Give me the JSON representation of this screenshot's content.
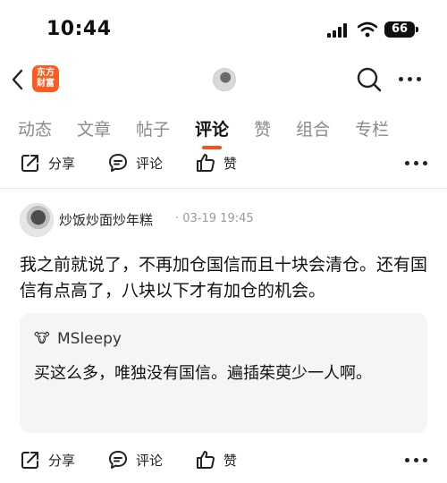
{
  "status_bar": {
    "time": "10:44",
    "battery": "66"
  },
  "nav": {
    "logo_line1": "东方",
    "logo_line2": "财富"
  },
  "tabs": [
    {
      "label": "动态"
    },
    {
      "label": "文章"
    },
    {
      "label": "帖子"
    },
    {
      "label": "评论",
      "active": true
    },
    {
      "label": "赞"
    },
    {
      "label": "组合"
    },
    {
      "label": "专栏"
    }
  ],
  "actions": {
    "share": "分享",
    "comment": "评论",
    "like": "赞"
  },
  "comment": {
    "user": "炒饭炒面炒年糕",
    "meta": "· 03-19 19:45",
    "text": "我之前就说了，不再加仓国信而且十块会清仓。还有国信有点高了，八块以下才有加仓的机会。",
    "quote": {
      "icon": "🐮",
      "user": "MSleepy",
      "text": "买这么多，唯独没有国信。遍插茱萸少一人啊。"
    }
  },
  "colors": {
    "accent": "#ff4d1a",
    "logo": "#ff5a1f"
  }
}
